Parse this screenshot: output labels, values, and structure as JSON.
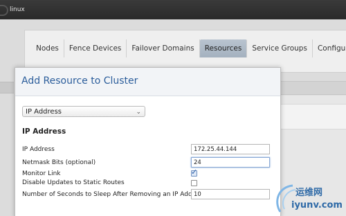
{
  "window": {
    "title": "linux"
  },
  "tabs": [
    {
      "label": "Nodes",
      "active": false
    },
    {
      "label": "Fence Devices",
      "active": false
    },
    {
      "label": "Failover Domains",
      "active": false
    },
    {
      "label": "Resources",
      "active": true
    },
    {
      "label": "Service Groups",
      "active": false
    },
    {
      "label": "Configure",
      "active": false
    }
  ],
  "modal": {
    "title": "Add Resource to Cluster",
    "resource_type": {
      "selected": "IP Address"
    },
    "section_title": "IP Address",
    "fields": {
      "ip_address": {
        "label": "IP Address",
        "value": "172.25.44.144"
      },
      "netmask_bits": {
        "label": "Netmask Bits (optional)",
        "value": "24"
      },
      "monitor_link": {
        "label": "Monitor Link",
        "checked": true
      },
      "disable_updates": {
        "label": "Disable Updates to Static Routes",
        "checked": false
      },
      "sleep_seconds": {
        "label": "Number of Seconds to Sleep After Removing an IP Address",
        "value": "10"
      }
    }
  },
  "watermark": {
    "cn": "运维网",
    "url": "iyunv.com"
  },
  "colors": {
    "accent": "#2b5d9b",
    "active_tab": "#a4b1bf",
    "topbar": "#2f2f2f"
  },
  "icons": {
    "select": "chevron-down-icon",
    "check": "checkmark-icon"
  }
}
